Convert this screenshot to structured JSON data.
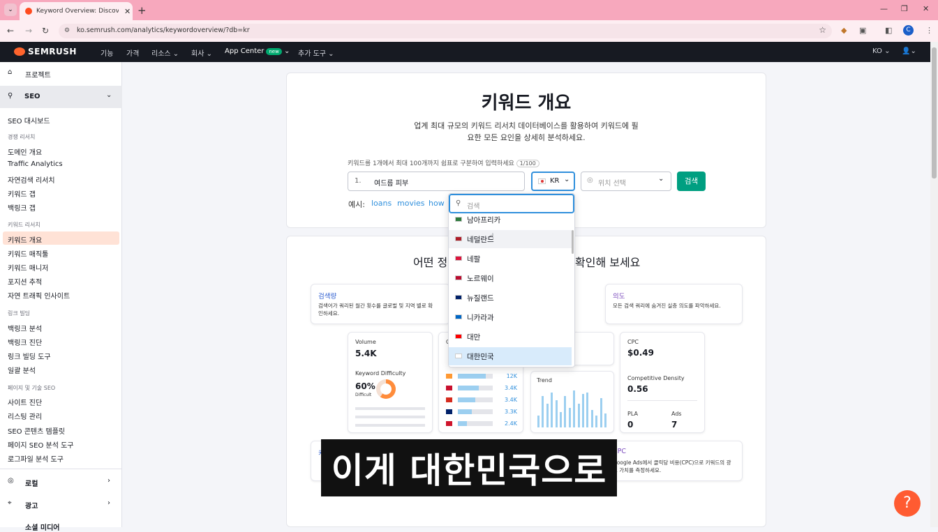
{
  "browser": {
    "tab_title": "Keyword Overview: Discover N",
    "url": "ko.semrush.com/analytics/keywordoverview/?db=kr",
    "profile_initial": "C"
  },
  "topnav": {
    "brand": "SEMRUSH",
    "items": [
      "기능",
      "가격",
      "리소스",
      "회사",
      "App Center",
      "추가 도구"
    ],
    "new_badge": "new",
    "lang": "KO"
  },
  "sidebar": {
    "projects": "프로젝트",
    "seo": "SEO",
    "seo_dashboard": "SEO 대시보드",
    "group1": "경쟁 리서치",
    "g1_items": [
      "도메인 개요",
      "Traffic Analytics",
      "자연검색 리서치",
      "키워드 갭",
      "백링크 갭"
    ],
    "group2": "키워드 리서치",
    "g2_items": [
      "키워드 개요",
      "키워드 매직툴",
      "키워드 매니저",
      "포지션 추적",
      "자연 트래픽 인사이트"
    ],
    "group3": "링크 빌딩",
    "g3_items": [
      "백링크 분석",
      "백링크 진단",
      "링크 빌딩 도구",
      "일괄 분석"
    ],
    "group4": "페이지 및 기술 SEO",
    "g4_items": [
      "사이트 진단",
      "리스팅 관리",
      "SEO 콘텐츠 템플릿",
      "페이지 SEO 분석 도구",
      "로그파일 분석 도구"
    ],
    "local": "로컬",
    "ads": "광고",
    "social": "소셜 미디어"
  },
  "main": {
    "title": "키워드 개요",
    "desc_line1": "업계 최대 규모의 키워드 리서치 데이터베이스를 활용하여 키워드에 필",
    "desc_line2": "요한 모든 요인을 상세히 분석하세요.",
    "input_hint": "키워드를 1개에서 최대 100개까지 쉼표로 구분하여 입력하세요",
    "counter": "1/100",
    "keyword_number": "1.",
    "keyword_value": "여드름 피부",
    "db_selected": "KR",
    "location_placeholder": "위치 선택",
    "search_button": "검색",
    "examples_label": "예시:",
    "examples": [
      "loans",
      "movies",
      "how"
    ]
  },
  "dropdown": {
    "search_placeholder": "검색",
    "items": [
      "남아프리카",
      "네덜란드",
      "네팔",
      "노르웨이",
      "뉴질랜드",
      "니카라과",
      "대만",
      "대한민국"
    ]
  },
  "section2": {
    "heading_left": "어떤 정",
    "heading_right": "확인해 보세요",
    "volume_title": "검색량",
    "volume_desc": "검색어가 쿼리된 월간 횟수를 글로벌 및 지역 별로 확인하세요.",
    "intent_title": "의도",
    "intent_desc": "모든 검색 쿼리에 숨겨진 실층 의도를 파악하세요.",
    "cpc_title": "CPC",
    "cpc_desc": "Google Ads에서 클릭당 비용(CPC)으로 키워드의 광고 가치를 측정하세요.",
    "kw_title_frag": "키",
    "volume_label": "Volume",
    "volume_value": "5.4K",
    "kd_label": "Keyword Difficulty",
    "kd_value": "60%",
    "kd_sub": "Difficult",
    "country_values": [
      "12K",
      "3.4K",
      "3.4K",
      "3.3K",
      "2.4K"
    ],
    "country_fractions": [
      0.8,
      0.6,
      0.5,
      0.4,
      0.25
    ],
    "trend_label": "Trend",
    "trend_bars": [
      0.3,
      0.8,
      0.6,
      0.9,
      0.7,
      0.4,
      0.8,
      0.5,
      0.95,
      0.6,
      0.85,
      0.9,
      0.45,
      0.3,
      0.75,
      0.35
    ],
    "cpc_label": "CPC",
    "cpc_value": "$0.49",
    "cd_label": "Competitive Density",
    "cd_value": "0.56",
    "pla_label": "PLA",
    "pla_value": "0",
    "ads_label": "Ads",
    "ads_value": "7",
    "c_frag": "C"
  },
  "caption": "이게 대한민국으로",
  "help": "?"
}
